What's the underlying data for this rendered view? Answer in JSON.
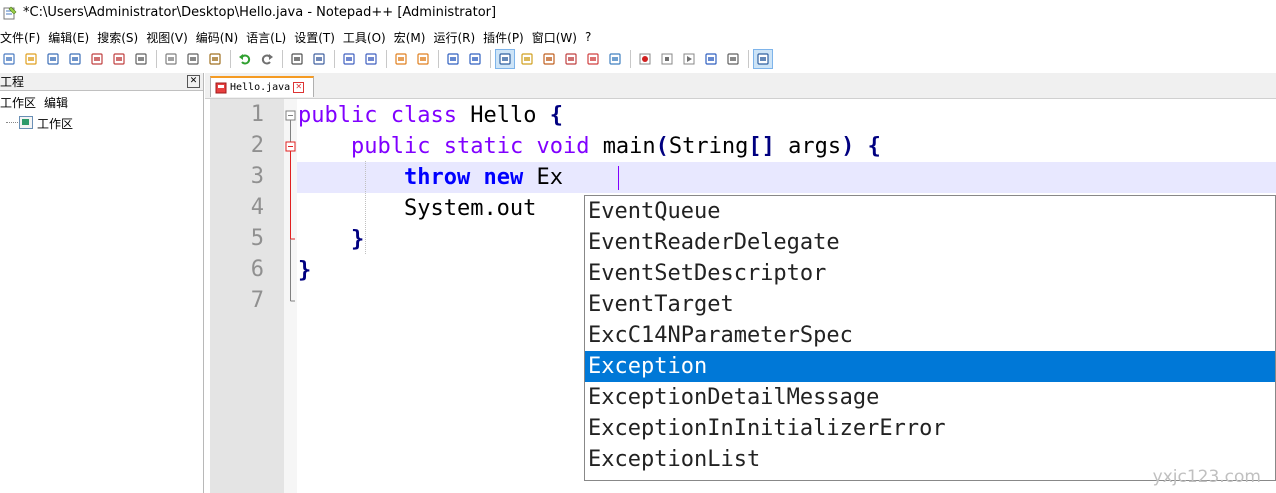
{
  "window": {
    "title": "*C:\\Users\\Administrator\\Desktop\\Hello.java - Notepad++ [Administrator]"
  },
  "menu": [
    "文件(F)",
    "编辑(E)",
    "搜索(S)",
    "视图(V)",
    "编码(N)",
    "语言(L)",
    "设置(T)",
    "工具(O)",
    "宏(M)",
    "运行(R)",
    "插件(P)",
    "窗口(W)",
    "?"
  ],
  "toolbar_icons": [
    "new-file-icon",
    "open-file-icon",
    "save-icon",
    "save-all-icon",
    "close-icon",
    "close-all-icon",
    "print-icon",
    "sep",
    "cut-icon",
    "copy-icon",
    "paste-icon",
    "sep",
    "undo-icon",
    "redo-icon",
    "sep",
    "find-icon",
    "replace-icon",
    "sep",
    "zoom-in-icon",
    "zoom-out-icon",
    "sep",
    "sync-v-icon",
    "sync-h-icon",
    "sep",
    "wrap-icon",
    "show-all-chars-icon",
    "sep",
    "indent-guide-icon",
    "udl-icon",
    "doc-map-icon",
    "function-list-icon",
    "folder-workspace-icon",
    "monitor-icon",
    "sep",
    "record-macro-icon",
    "stop-record-icon",
    "play-macro-icon",
    "run-multiple-icon",
    "save-macro-icon",
    "sep",
    "panel-toggle-icon"
  ],
  "panel": {
    "title": "工程",
    "menu": [
      "工作区",
      "编辑"
    ],
    "tree_item": "工作区"
  },
  "tab": {
    "label": "Hello.java"
  },
  "editor": {
    "line_numbers": [
      "1",
      "2",
      "3",
      "4",
      "5",
      "6",
      "7"
    ],
    "lines": {
      "l1_kw1": "public",
      "l1_kw2": "class",
      "l1_name": "Hello",
      "l1_brace": "{",
      "l2_kw1": "public",
      "l2_kw2": "static",
      "l2_kw3": "void",
      "l2_name": "main",
      "l2_p1": "(",
      "l2_type": "String",
      "l2_br": "[]",
      "l2_arg": "args",
      "l2_p2": ")",
      "l2_brace": "{",
      "l3_kw1": "throw",
      "l3_kw2": "new",
      "l3_typed": "Ex",
      "l4_text": "System.out",
      "l5_brace": "}",
      "l6_brace": "}"
    }
  },
  "autocomplete": {
    "items": [
      "EventQueue",
      "EventReaderDelegate",
      "EventSetDescriptor",
      "EventTarget",
      "ExcC14NParameterSpec",
      "Exception",
      "ExceptionDetailMessage",
      "ExceptionInInitializerError",
      "ExceptionList"
    ],
    "selected_index": 5
  },
  "watermark": "yxjc123.com"
}
